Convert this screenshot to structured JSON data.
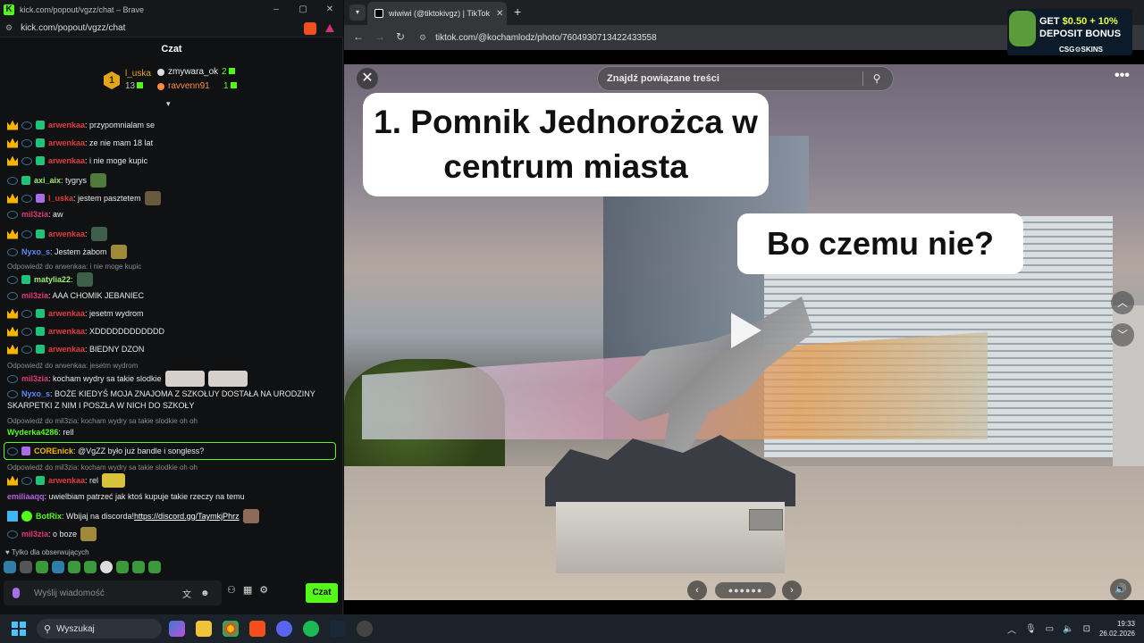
{
  "kick": {
    "window_title": "kick.com/popout/vgzz/chat – Brave",
    "url": "kick.com/popout/vgzz/chat",
    "window_controls": [
      "–",
      "▢",
      "✕"
    ],
    "chat_header": "Czat",
    "top_gifters": {
      "first": {
        "name": "l_uska",
        "count": "13"
      },
      "second": {
        "name": "zmywara_ok",
        "count": "2"
      },
      "third": {
        "name": "ravvenn91",
        "count": "1"
      }
    },
    "messages": [
      {
        "user": "arwenkaa",
        "text": ": przypomnialam se"
      },
      {
        "user": "arwenkaa",
        "text": ": ze nie mam 18 lat"
      },
      {
        "user": "arwenkaa",
        "text": ": i nie moge kupic"
      },
      {
        "user": "axi_aix",
        "text": ": tygrys"
      },
      {
        "user": "l_uska",
        "text": ": jestem pasztetem"
      },
      {
        "user": "mil3zia",
        "text": ": aw"
      },
      {
        "user": "arwenkaa",
        "text": ":"
      },
      {
        "user": "Nyxo_s",
        "text": ": Jestem żabom"
      },
      {
        "reply": "Odpowiedź do arwenkaa: i nie moge kupic"
      },
      {
        "user": "matylia22",
        "text": ":"
      },
      {
        "user": "mil3zia",
        "text": ": AAA CHOMIK JEBANIEC"
      },
      {
        "user": "arwenkaa",
        "text": ": jesetm wydrom"
      },
      {
        "user": "arwenkaa",
        "text": ": XDDDDDDDDDDDD"
      },
      {
        "user": "arwenkaa",
        "text": ": BIEDNY DZON"
      },
      {
        "reply": "Odpowiedź do arwenkaa: jesetm wydrom"
      },
      {
        "user": "mil3zia",
        "text": ": kocham wydry sa takie slodkie"
      },
      {
        "user": "Nyxo_s",
        "text": ": BOŻE KIEDYŚ MOJA ZNAJOMA Z SZKOŁUY DOSTAŁA NA URODZINY"
      },
      {
        "text": "SKARPETKI Z NIM I POSZŁA W NICH DO SZKOŁY"
      },
      {
        "reply": "Odpowiedź do mil3zia: kocham wydry sa takie slodkie oh oh"
      },
      {
        "user": "Wyderka4286",
        "text": ": rell"
      },
      {
        "user": "COREnick",
        "text": ": @VgZZ było już bandle i songless?"
      },
      {
        "reply": "Odpowiedź do mil3zia: kocham wydry sa takie slodkie oh oh"
      },
      {
        "user": "arwenkaa",
        "text": ": rel"
      },
      {
        "user": "emiliaaqq",
        "text": ": uwielbiam patrzeć jak ktoś kupuje takie rzeczy na temu"
      },
      {
        "user": "BotRix",
        "text": ": Wbijaj na discorda! ",
        "link": "https://discord.gg/TaymkjPhrz"
      },
      {
        "user": "mil3zia",
        "text": ": o boze"
      }
    ],
    "followers_only": "♥ Tylko dla obserwujących",
    "input_placeholder": "Wyślij wiadomość",
    "send_label": "Czat"
  },
  "browser": {
    "tab_title": "wiwiwi (@tiktokivgz) | TikTok",
    "url": "tiktok.com/@kochamlodz/photo/7604930713422433558",
    "ad": {
      "line1a": "GET ",
      "line1b": "$0.50 + 10%",
      "line2": "DEPOSIT BONUS",
      "line3": "CSG⚙SKINS"
    },
    "search_placeholder": "Znajdź powiązane treści",
    "caption1": "1. Pomnik Jednorożca w centrum miasta",
    "caption2": "Bo czemu nie?",
    "dots": "●●●●●●"
  },
  "taskbar": {
    "search_label": "Wyszukaj",
    "time": "19:33",
    "date": "26.02.2026"
  },
  "colors": {
    "kick_green": "#53fc18",
    "accent_red": "#e03b3b"
  }
}
